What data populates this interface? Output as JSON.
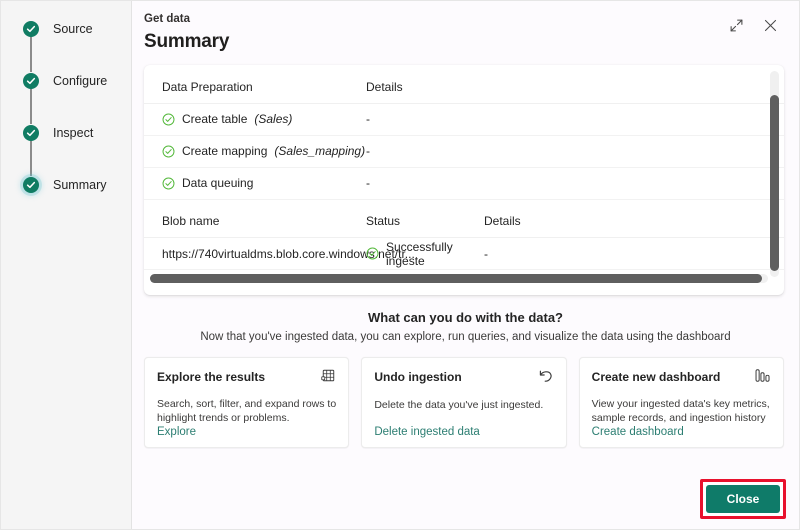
{
  "wizard": {
    "steps": [
      {
        "label": "Source",
        "state": "complete",
        "icon": "check-circle-icon"
      },
      {
        "label": "Configure",
        "state": "complete",
        "icon": "check-circle-icon"
      },
      {
        "label": "Inspect",
        "state": "complete",
        "icon": "check-circle-icon"
      },
      {
        "label": "Summary",
        "state": "current",
        "icon": "check-circle-icon"
      }
    ]
  },
  "header": {
    "eyebrow": "Get data",
    "title": "Summary",
    "expand_icon": "expand-icon",
    "close_icon": "close-icon"
  },
  "summary_table": {
    "prep_headers": {
      "name": "Data Preparation",
      "details": "Details"
    },
    "prep_rows": [
      {
        "status_icon": "check-circle-icon",
        "name": "Create table",
        "detail_name": "(Sales)",
        "details": "-"
      },
      {
        "status_icon": "check-circle-icon",
        "name": "Create mapping",
        "detail_name": "(Sales_mapping)",
        "details": "-"
      },
      {
        "status_icon": "check-circle-icon",
        "name": "Data queuing",
        "detail_name": "",
        "details": "-"
      }
    ],
    "blob_headers": {
      "name": "Blob name",
      "status": "Status",
      "details": "Details"
    },
    "blob_rows": [
      {
        "name": "https://740virtualdms.blob.core.windows.net/tr...",
        "status_icon": "check-circle-icon",
        "status": "Successfully ingeste",
        "details": "-"
      }
    ]
  },
  "promo": {
    "title": "What can you do with the data?",
    "subtitle": "Now that you've ingested data, you can explore, run queries, and visualize the data using the dashboard",
    "cards": [
      {
        "title": "Explore the results",
        "icon": "table-grid-icon",
        "description": "Search, sort, filter, and expand rows to highlight trends or problems.",
        "link": "Explore"
      },
      {
        "title": "Undo ingestion",
        "icon": "undo-arrow-icon",
        "description": "Delete the data you've just ingested.",
        "link": "Delete ingested data"
      },
      {
        "title": "Create new dashboard",
        "icon": "bar-chart-icon",
        "description": "View your ingested data's key metrics, sample records, and ingestion history",
        "link": "Create dashboard"
      }
    ]
  },
  "footer": {
    "close_label": "Close"
  },
  "colors": {
    "accent_teal": "#0f7b69",
    "step_dot": "#107c63",
    "success_green": "#53b83a",
    "link_teal": "#2c7e72",
    "highlight_red": "#e8112d",
    "pane_bg": "#fdfbfe",
    "rail_bg": "#f5f5f5"
  }
}
